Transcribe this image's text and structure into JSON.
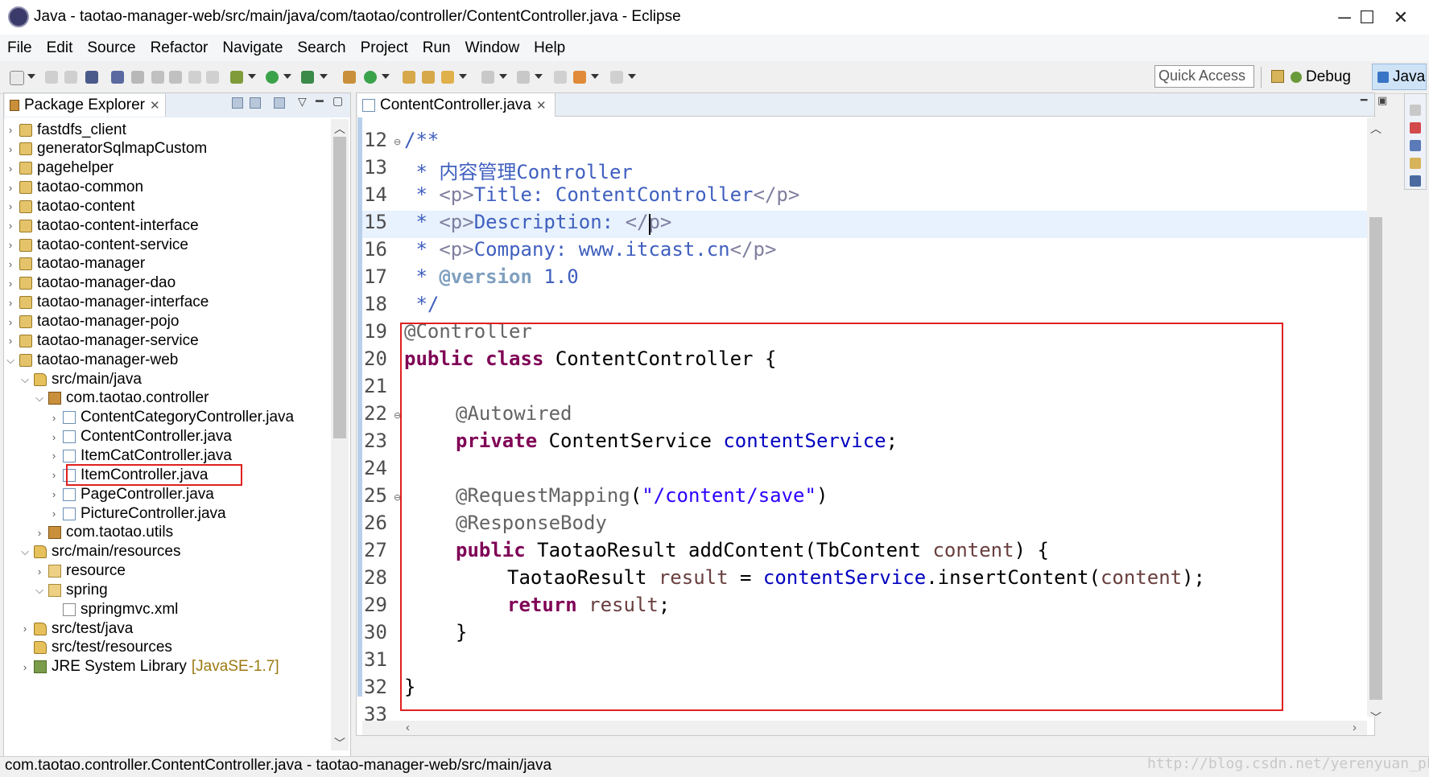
{
  "window": {
    "title": "Java - taotao-manager-web/src/main/java/com/taotao/controller/ContentController.java - Eclipse",
    "minimize": "─",
    "maximize": "☐",
    "close": "✕"
  },
  "menu": [
    "File",
    "Edit",
    "Source",
    "Refactor",
    "Navigate",
    "Search",
    "Project",
    "Run",
    "Window",
    "Help"
  ],
  "toolbar": {
    "quick_access": "Quick Access",
    "perspectives": {
      "debug": "Debug",
      "java": "Java"
    }
  },
  "package_explorer": {
    "title": "Package Explorer",
    "tab_close": "✕",
    "tree": [
      {
        "label": "fastdfs_client",
        "icon": "project-icon",
        "expanded": false
      },
      {
        "label": "generatorSqlmapCustom",
        "icon": "project-icon",
        "expanded": false
      },
      {
        "label": "pagehelper",
        "icon": "project-icon",
        "expanded": false
      },
      {
        "label": "taotao-common",
        "icon": "project-icon",
        "expanded": false
      },
      {
        "label": "taotao-content",
        "icon": "project-icon",
        "expanded": false
      },
      {
        "label": "taotao-content-interface",
        "icon": "project-icon",
        "expanded": false
      },
      {
        "label": "taotao-content-service",
        "icon": "project-icon",
        "expanded": false
      },
      {
        "label": "taotao-manager",
        "icon": "project-icon",
        "expanded": false
      },
      {
        "label": "taotao-manager-dao",
        "icon": "project-icon",
        "expanded": false
      },
      {
        "label": "taotao-manager-interface",
        "icon": "project-icon",
        "expanded": false
      },
      {
        "label": "taotao-manager-pojo",
        "icon": "project-icon",
        "expanded": false
      },
      {
        "label": "taotao-manager-service",
        "icon": "project-icon",
        "expanded": false
      },
      {
        "label": "taotao-manager-web",
        "icon": "project-icon",
        "expanded": true
      },
      {
        "label": "src/main/java",
        "icon": "source-folder-icon",
        "expanded": true
      },
      {
        "label": "com.taotao.controller",
        "icon": "package-icon",
        "expanded": true
      },
      {
        "label": "ContentCategoryController.java",
        "icon": "java-file-icon",
        "expanded": false
      },
      {
        "label": "ContentController.java",
        "icon": "java-file-icon",
        "expanded": false,
        "selected": true
      },
      {
        "label": "ItemCatController.java",
        "icon": "java-file-icon",
        "expanded": false
      },
      {
        "label": "ItemController.java",
        "icon": "java-file-icon",
        "expanded": false
      },
      {
        "label": "PageController.java",
        "icon": "java-file-icon",
        "expanded": false
      },
      {
        "label": "PictureController.java",
        "icon": "java-file-icon",
        "expanded": false
      },
      {
        "label": "com.taotao.utils",
        "icon": "package-icon",
        "expanded": false
      },
      {
        "label": "src/main/resources",
        "icon": "source-folder-icon",
        "expanded": true
      },
      {
        "label": "resource",
        "icon": "folder-icon",
        "expanded": false
      },
      {
        "label": "spring",
        "icon": "folder-icon",
        "expanded": true
      },
      {
        "label": "springmvc.xml",
        "icon": "xml-file-icon",
        "expanded": null
      },
      {
        "label": "src/test/java",
        "icon": "source-folder-icon",
        "expanded": false
      },
      {
        "label": "src/test/resources",
        "icon": "source-folder-icon",
        "expanded": null
      },
      {
        "label": "JRE System Library",
        "extra": "[JavaSE-1.7]",
        "icon": "library-icon",
        "expanded": false
      }
    ]
  },
  "editor": {
    "tab_label": "ContentController.java",
    "tab_close": "✕",
    "line_numbers": [
      "12",
      "13",
      "14",
      "15",
      "16",
      "17",
      "18",
      "19",
      "20",
      "21",
      "22",
      "23",
      "24",
      "25",
      "26",
      "27",
      "28",
      "29",
      "30",
      "31",
      "32",
      "33"
    ],
    "cursor_line": "15",
    "code": {
      "l12": "/**",
      "l13_star": " * ",
      "l13_text": "内容管理Controller",
      "l14_tag_open": "<p>",
      "l14_text": "Title: ContentController",
      "l14_tag_close": "</p>",
      "l15_tag_open": "<p>",
      "l15_text": "Description: ",
      "l15_tag_close": "</p>",
      "l16_tag_open": "<p>",
      "l16_text": "Company: www.itcast.cn",
      "l16_tag_close": "</p>",
      "l17_tag": "@version",
      "l17_text": " 1.0",
      "l18": " */",
      "l19": "@Controller",
      "l20_kw1": "public",
      "l20_kw2": "class",
      "l20_rest": " ContentController {",
      "l22": "@Autowired",
      "l23_kw": "private",
      "l23_type": " ContentService ",
      "l23_field": "contentService",
      "l23_end": ";",
      "l25_ann": "@RequestMapping",
      "l25_open": "(",
      "l25_str": "\"/content/save\"",
      "l25_close": ")",
      "l26": "@ResponseBody",
      "l27_kw": "public",
      "l27_sig": " TaotaoResult addContent(TbContent ",
      "l27_param": "content",
      "l27_end": ") {",
      "l28_type": "TaotaoResult ",
      "l28_var": "result",
      "l28_eq": " = ",
      "l28_field": "contentService",
      "l28_call": ".insertContent(",
      "l28_arg": "content",
      "l28_end": ");",
      "l29_kw": "return",
      "l29_var": "result",
      "l29_end": ";",
      "l30": "}",
      "l32": "}"
    }
  },
  "status": {
    "text": "com.taotao.controller.ContentController.java - taotao-manager-web/src/main/java",
    "watermark": "http://blog.csdn.net/yerenyuan_pku"
  },
  "colors": {
    "keyword": "#7f0055",
    "javadoc": "#3f5fbf",
    "annotation": "#646464",
    "field": "#0000c0",
    "string": "#2a00ff",
    "highlight_box": "#e02020"
  }
}
